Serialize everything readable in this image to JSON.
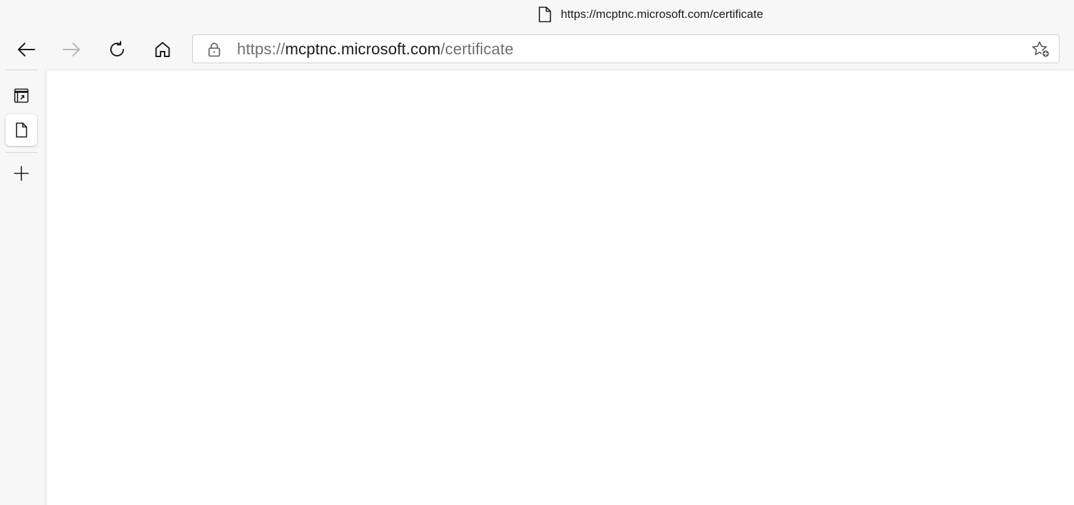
{
  "window": {
    "title": "https://mcptnc.microsoft.com/certificate",
    "title_icon": "page-icon"
  },
  "toolbar": {
    "back_icon": "back-arrow-icon",
    "forward_icon": "forward-arrow-icon",
    "forward_enabled": false,
    "refresh_icon": "refresh-icon",
    "home_icon": "home-icon"
  },
  "address_bar": {
    "lock_icon": "lock-icon",
    "url_scheme": "https://",
    "url_host": "mcptnc.microsoft.com",
    "url_path": "/certificate",
    "favorite_icon": "add-favorite-icon"
  },
  "sidebar": {
    "tab_actions_icon": "tab-actions-icon",
    "active_tab_icon": "page-icon",
    "new_tab_icon": "plus-icon"
  },
  "colors": {
    "chrome_background": "#f7f7f7",
    "page_background": "#ffffff",
    "url_dim": "#707070",
    "icon": "#1a1a1a",
    "icon_disabled": "#b8b8b8"
  }
}
